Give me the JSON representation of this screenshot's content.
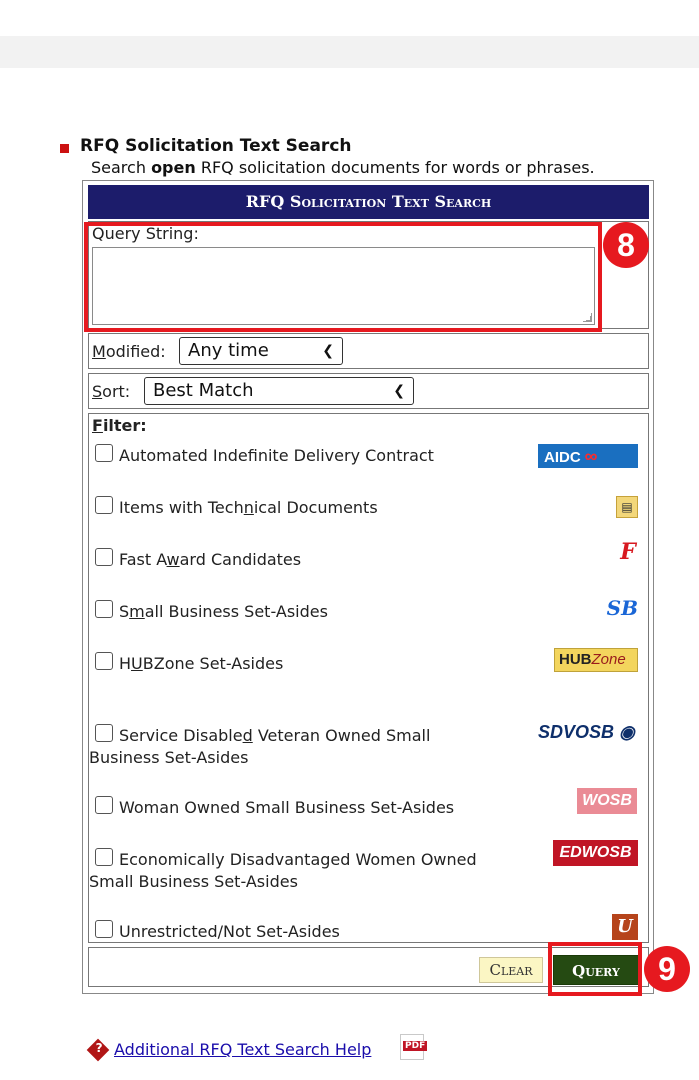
{
  "section": {
    "title": "RFQ Solicitation Text Search",
    "desc_pre": "Search ",
    "desc_bold": "open",
    "desc_post": " RFQ solicitation documents for words or phrases."
  },
  "panel": {
    "header": "RFQ Solicitation Text Search",
    "query_label": "Query String:",
    "modified_label_accesskey": "M",
    "modified_label_rest": "odified:",
    "modified_value": "Any time",
    "sort_label_accesskey": "S",
    "sort_label_rest": "ort:",
    "sort_value": "Best Match",
    "filter_label_accesskey": "F",
    "filter_label_rest": "ilter:"
  },
  "filters": [
    {
      "text": "Automated Indefinite Delivery Contract",
      "badge": "AIDC"
    },
    {
      "text_a": "Items with Tech",
      "text_u": "n",
      "text_b": "ical Documents",
      "badge": "tech-doc-icon"
    },
    {
      "text_a": "Fast A",
      "text_u": "w",
      "text_b": "ard Candidates",
      "badge": "F"
    },
    {
      "text_a": "S",
      "text_u": "m",
      "text_b": "all Business Set-Asides",
      "badge": "SB"
    },
    {
      "text_a": "H",
      "text_u": "U",
      "text_b": "BZone Set-Asides",
      "badge_a": "HUB",
      "badge_b": "Zone"
    },
    {
      "text_a": "Service Disable",
      "text_u": "d",
      "text_b": " Veteran Owned Small",
      "text_2": "Business Set-Asides",
      "badge": "SDVOSB"
    },
    {
      "text": "Woman Owned Small Business Set-Asides",
      "badge": "WOSB"
    },
    {
      "text": "Economically Disadvantaged Women Owned",
      "text_2": "Small Business Set-Asides",
      "badge": "EDWOSB"
    },
    {
      "text": "Unrestricted/Not Set-Asides",
      "badge": "U"
    }
  ],
  "buttons": {
    "clear": "Clear",
    "query": "Query"
  },
  "annotations": {
    "step_8": "8",
    "step_9": "9"
  },
  "help": {
    "link": "Additional RFQ Text Search Help",
    "pdf": "PDF"
  },
  "colors": {
    "header_bg": "#1c1c6b",
    "annotation_red": "#e6191f",
    "query_button_bg": "#254a12",
    "clear_button_bg": "#fbf6c4",
    "aidc_blue": "#1a6fc0"
  }
}
